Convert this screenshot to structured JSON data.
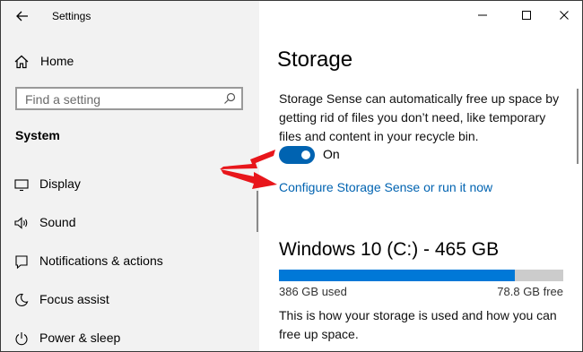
{
  "window": {
    "title": "Settings"
  },
  "sidebar": {
    "home_label": "Home",
    "search_placeholder": "Find a setting",
    "section_title": "System",
    "items": [
      {
        "label": "Display",
        "icon": "monitor-icon"
      },
      {
        "label": "Sound",
        "icon": "speaker-icon"
      },
      {
        "label": "Notifications & actions",
        "icon": "notification-icon"
      },
      {
        "label": "Focus assist",
        "icon": "moon-icon"
      },
      {
        "label": "Power & sleep",
        "icon": "power-icon"
      }
    ]
  },
  "main": {
    "title": "Storage",
    "description": "Storage Sense can automatically free up space by getting rid of files you don’t need, like temporary files and content in your recycle bin.",
    "toggle_state": "On",
    "toggle_on": true,
    "configure_link": "Configure Storage Sense or run it now",
    "drive": {
      "name": "Windows 10 (C:) - 465 GB",
      "used_label": "386 GB used",
      "free_label": "78.8 GB free",
      "used_fraction": 0.83
    },
    "usage_description": "This is how your storage is used and how you can free up space."
  },
  "colors": {
    "accent": "#0078d7",
    "link": "#0063b1",
    "annotation_arrow": "#e8161b"
  }
}
